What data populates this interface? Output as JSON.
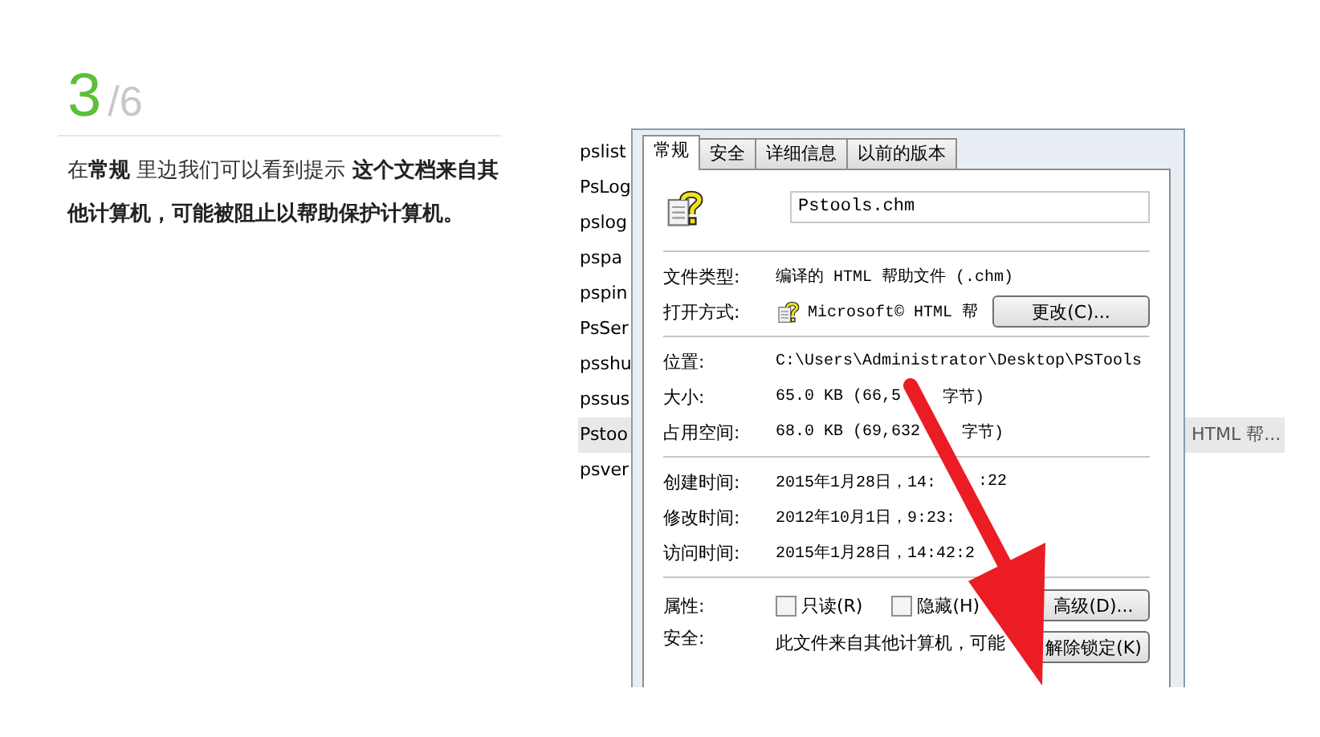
{
  "step": {
    "number": "3",
    "total": "/6"
  },
  "description": "在**常规** 里边我们可以看到提示 **这个文档来自其他计算机，可能被阻止以帮助保护计算机。**",
  "screenshot": {
    "files": [
      {
        "name": "pslist",
        "selected": false
      },
      {
        "name": "PsLog",
        "selected": false
      },
      {
        "name": "pslog",
        "selected": false
      },
      {
        "name": "pspa",
        "selected": false
      },
      {
        "name": "pspin",
        "selected": false
      },
      {
        "name": "PsSer",
        "selected": false
      },
      {
        "name": "psshu",
        "selected": false
      },
      {
        "name": "pssus",
        "selected": false
      },
      {
        "name": "Pstoo",
        "selected": true,
        "column_2": "HTML 帮..."
      },
      {
        "name": "psver",
        "selected": false
      }
    ],
    "dialog": {
      "tabs": [
        {
          "label": "常规",
          "selected": true
        },
        {
          "label": "安全",
          "selected": false
        },
        {
          "label": "详细信息",
          "selected": false
        },
        {
          "label": "以前的版本",
          "selected": false
        }
      ],
      "file_name": "Pstools.chm",
      "sections": [
        [
          {
            "kind": "text",
            "label": "文件类型:",
            "value": [
              "编译的 HTML 帮助文件 (.chm)"
            ]
          },
          {
            "kind": "app",
            "label": "打开方式:",
            "value": [
              "Microsoft© HTML 帮"
            ],
            "button": "更改(C)..."
          }
        ],
        [
          {
            "kind": "text",
            "label": "位置:",
            "value": [
              "C:\\Users\\Administrator\\Desktop\\PSTools"
            ]
          },
          {
            "kind": "text",
            "label": "大小:",
            "value": [
              "65.0 KB (66,5",
              "字节)"
            ]
          },
          {
            "kind": "text",
            "label": "占用空间:",
            "value": [
              "68.0 KB (69,632",
              "字节)"
            ]
          }
        ],
        [
          {
            "kind": "text",
            "label": "创建时间:",
            "value": [
              "2015年1月28日，14:",
              ":22"
            ]
          },
          {
            "kind": "text",
            "label": "修改时间:",
            "value": [
              "2012年10月1日，9:23:"
            ]
          },
          {
            "kind": "text",
            "label": "访问时间:",
            "value": [
              "2015年1月28日，14:42:2"
            ]
          }
        ],
        [
          {
            "kind": "attributes",
            "label": "属性:",
            "checkboxes": [
              {
                "label": "只读(R)",
                "checked": false
              },
              {
                "label": "隐藏(H)",
                "checked": false
              }
            ],
            "button": "高级(D)..."
          },
          {
            "kind": "security",
            "label": "安全:",
            "value": [
              "此文件来自其他计算机，可能"
            ],
            "button": "解除锁定(K)"
          }
        ]
      ]
    }
  }
}
